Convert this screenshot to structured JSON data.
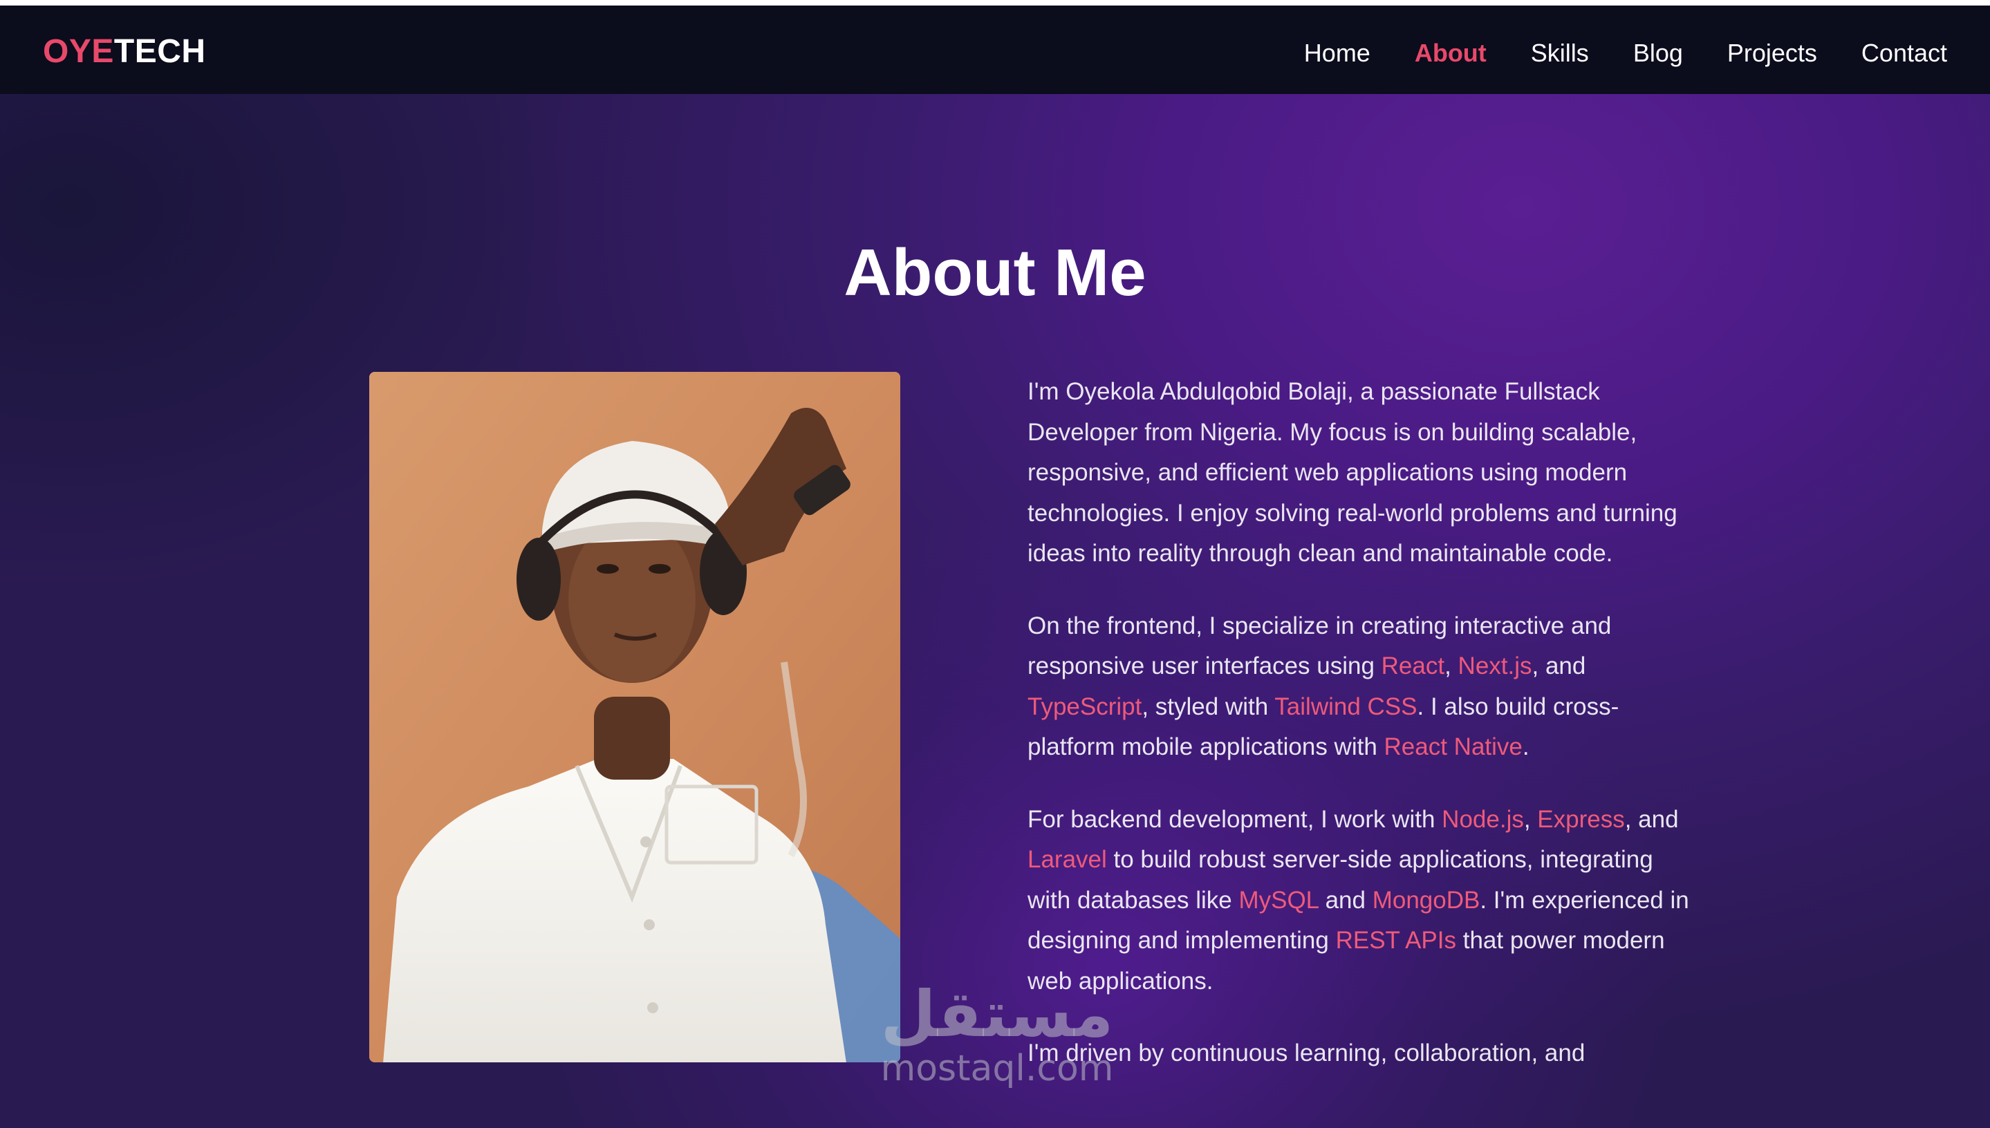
{
  "brand": {
    "logo_first": "O",
    "logo_accent": "YE",
    "logo_rest": "TECH",
    "accent_color": "#e8496b"
  },
  "nav": {
    "items": [
      {
        "label": "Home",
        "active": false
      },
      {
        "label": "About",
        "active": true
      },
      {
        "label": "Skills",
        "active": false
      },
      {
        "label": "Blog",
        "active": false
      },
      {
        "label": "Projects",
        "active": false
      },
      {
        "label": "Contact",
        "active": false
      }
    ]
  },
  "page": {
    "title": "About Me"
  },
  "about": {
    "p1": "I'm Oyekola Abdulqobid Bolaji, a passionate Fullstack Developer from Nigeria. My focus is on building scalable, responsive, and efficient web applications using modern technologies. I enjoy solving real-world problems and turning ideas into reality through clean and maintainable code.",
    "p2": {
      "t1": "On the frontend, I specialize in creating interactive and responsive user interfaces using ",
      "react": "React",
      "t2": ", ",
      "next": "Next.js",
      "t3": ", and ",
      "ts": "TypeScript",
      "t4": ", styled with ",
      "tailwind": "Tailwind CSS",
      "t5": ". I also build cross-platform mobile applications with ",
      "rn": "React Native",
      "t6": "."
    },
    "p3": {
      "t1": "For backend development, I work with ",
      "node": "Node.js",
      "t2": ", ",
      "express": "Express",
      "t3": ", and ",
      "laravel": "Laravel",
      "t4": " to build robust server-side applications, integrating with databases like ",
      "mysql": "MySQL",
      "t5": " and ",
      "mongo": "MongoDB",
      "t6": ". I'm experienced in designing and implementing ",
      "rest": "REST APIs",
      "t7": " that power modern web applications."
    },
    "p4": "I'm driven by continuous learning, collaboration, and"
  },
  "watermark": {
    "arabic": "مستقل",
    "latin": "mostaql.com"
  },
  "colors": {
    "highlight": "#ef5a7a",
    "nav_bg": "#0b0c1c",
    "bg_purple": "#4a1b84"
  }
}
